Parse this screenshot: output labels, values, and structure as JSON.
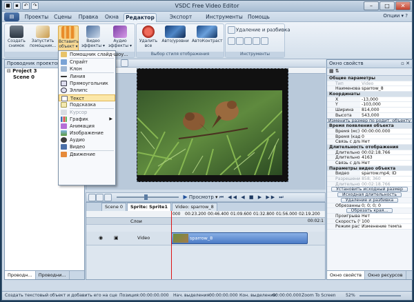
{
  "window": {
    "title": "VSDC Free Video Editor",
    "options_label": "Опции"
  },
  "menu": {
    "file": "",
    "tabs": [
      "Проекты",
      "Сцены",
      "Правка",
      "Окна",
      "Редактор",
      "Экспорт проекта",
      "Инструменты",
      "Помощь"
    ],
    "active": "Редактор"
  },
  "ribbon": {
    "buttons": [
      {
        "label": "Создать снимок",
        "icon": "camera-icon"
      },
      {
        "label": "Запустить помощник...",
        "icon": "wizard-icon"
      },
      {
        "label": "Вставить объект",
        "icon": "insert-object-icon"
      },
      {
        "label": "Видео эффекты",
        "icon": "video-effects-icon"
      },
      {
        "label": "Аудио эффекты",
        "icon": "audio-effects-icon"
      },
      {
        "label": "Удалить все",
        "icon": "remove-all-icon"
      },
      {
        "label": "Авто/уровни",
        "icon": "auto-levels-icon"
      },
      {
        "label": "АвтоКонтраст",
        "icon": "auto-contrast-icon"
      }
    ],
    "group_labels": [
      "Р",
      "Выбор стиля отображения",
      "Инструменты"
    ],
    "tools_label": "Удаление и разбивка"
  },
  "left_panel": {
    "title": "Проводник проектов",
    "project": "Project 3",
    "scene": "Scene 0",
    "tabs": [
      "Проводн...",
      "Проводни..."
    ]
  },
  "insert_menu": {
    "items": [
      {
        "label": "Помощник слайд-шоу...",
        "state": "normal"
      },
      {
        "label": "Спрайт",
        "state": "normal"
      },
      {
        "label": "Клон",
        "state": "normal"
      },
      {
        "label": "Линия",
        "state": "normal"
      },
      {
        "label": "Прямоугольник",
        "state": "normal"
      },
      {
        "label": "Эллипс",
        "state": "normal"
      },
      {
        "label": "Текст",
        "state": "highlighted"
      },
      {
        "label": "Подсказка",
        "state": "normal"
      },
      {
        "label": "Курсор",
        "state": "disabled"
      },
      {
        "label": "График",
        "state": "normal",
        "submenu": true
      },
      {
        "label": "Анимация",
        "state": "normal"
      },
      {
        "label": "Изображение",
        "state": "normal"
      },
      {
        "label": "Аудио",
        "state": "normal"
      },
      {
        "label": "Видео",
        "state": "normal"
      },
      {
        "label": "Движение",
        "state": "normal"
      }
    ]
  },
  "player": {
    "preview": "Просмотр"
  },
  "timeline": {
    "tabs": [
      "Scene 0",
      "Sprite: Sprite1",
      "Video: sparrow_8"
    ],
    "active_tab": "Sprite: Sprite1",
    "ticks": [
      "000",
      "00:23.200",
      "00:46.400",
      "01:09.600",
      "01:32.800",
      "01:56.000",
      "02:19.200"
    ],
    "end_time": "00:02:1",
    "tracks": [
      {
        "name": "Слои",
        "clip": ""
      },
      {
        "name": "Video",
        "clip": "sparrow_8"
      }
    ]
  },
  "properties": {
    "title": "Окно свойств",
    "rows": [
      {
        "type": "sec",
        "k": "Общие параметры"
      },
      {
        "type": "row",
        "k": "Тип",
        "v": "Video",
        "dim": true
      },
      {
        "type": "row",
        "k": "Наименование",
        "v": "sparrow_8"
      },
      {
        "type": "sec",
        "k": "Координаты"
      },
      {
        "type": "row",
        "k": "X",
        "v": "-13,000"
      },
      {
        "type": "row",
        "k": "Y",
        "v": "-103,000"
      },
      {
        "type": "row",
        "k": "Ширина",
        "v": "814,000"
      },
      {
        "type": "row",
        "k": "Высота",
        "v": "543,000"
      },
      {
        "type": "btn",
        "k": "Изменить размер по родит. объекту"
      },
      {
        "type": "sec",
        "k": "Время появления объекта"
      },
      {
        "type": "row",
        "k": "Время (мс)",
        "v": "00:00:00.000"
      },
      {
        "type": "row",
        "k": "Время (кадр)",
        "v": "0"
      },
      {
        "type": "row",
        "k": "Связь с длител",
        "v": "Нет"
      },
      {
        "type": "sec",
        "k": "Длительность отображения"
      },
      {
        "type": "row",
        "k": "Длительность",
        "v": "00:02:18.766"
      },
      {
        "type": "row",
        "k": "Длительность",
        "v": "4163"
      },
      {
        "type": "row",
        "k": "Связь с длител",
        "v": "Нет"
      },
      {
        "type": "sec",
        "k": "Параметры видео объекта"
      },
      {
        "type": "row",
        "k": "Видео",
        "v": "sparrow.mp4; ID"
      },
      {
        "type": "row",
        "k": "Разрешение",
        "v": "858; 360",
        "dim": true
      },
      {
        "type": "row",
        "k": "Длительность",
        "v": "00:02:18.766",
        "dim": true
      },
      {
        "type": "btn",
        "k": "Установить исходный размер"
      },
      {
        "type": "btn",
        "k": "Исходная длительность"
      },
      {
        "type": "btn",
        "k": "Удаление и разбивка"
      },
      {
        "type": "row",
        "k": "Обрезанные края",
        "v": "0; 0; 0; 0"
      },
      {
        "type": "btn",
        "k": "Обрезать края..."
      },
      {
        "type": "row",
        "k": "Проигрывать с ко",
        "v": "Нет"
      },
      {
        "type": "row",
        "k": "Скорость (%)",
        "v": "100"
      },
      {
        "type": "row",
        "k": "Режим растяжен",
        "v": "Изменение темпа"
      }
    ],
    "tabs": [
      "Окно свойств",
      "Окно ресурсов"
    ]
  },
  "status": {
    "hint": "Создать текстовый объект и добавить его на сце",
    "pos_label": "Позиция:",
    "pos": "00:00:00.000",
    "start_label": "Нач. выделения:",
    "start": "00:00:00.000",
    "end_label": "Кон. выделения:",
    "end": "00:00:00.000",
    "zoom_label": "Zoom To Screen",
    "zoom": "52%"
  }
}
